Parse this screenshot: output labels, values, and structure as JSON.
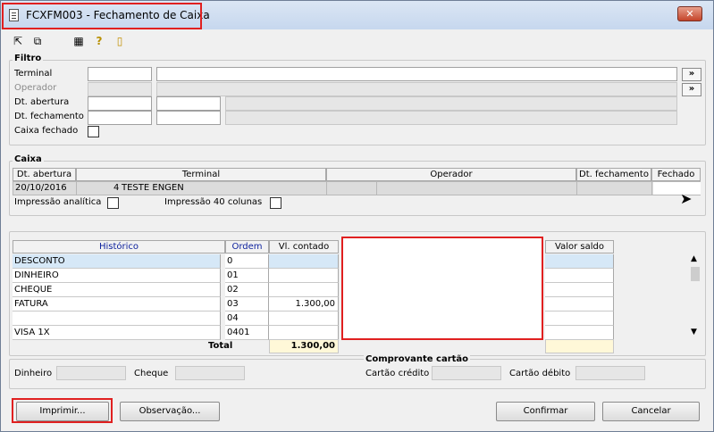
{
  "window": {
    "title": "FCXFM003 - Fechamento de Caixa",
    "close_label": "✕"
  },
  "toolbar": {
    "icons": [
      "first-record-icon",
      "multi-window-icon",
      "calendar-grid-icon",
      "help-icon",
      "exit-door-icon"
    ]
  },
  "filtro": {
    "title": "Filtro",
    "terminal_label": "Terminal",
    "operador_label": "Operador",
    "dt_abertura_label": "Dt. abertura",
    "dt_fechamento_label": "Dt. fechamento",
    "caixa_fechado_label": "Caixa fechado",
    "lookup_label": "»"
  },
  "caixa": {
    "title": "Caixa",
    "columns": [
      "Dt. abertura",
      "Terminal",
      "Operador",
      "Dt. fechamento",
      "Fechado"
    ],
    "row": {
      "dt_abertura": "20/10/2016",
      "terminal_num": "4",
      "terminal_name": "TESTE ENGEN"
    },
    "impressao_analitica_label": "Impressão analítica",
    "impressao_40_label": "Impressão 40 colunas"
  },
  "valores": {
    "columns": {
      "historico": "Histórico",
      "ordem": "Ordem",
      "vl_contado": "Vl. contado",
      "valor_saldo": "Valor saldo"
    },
    "rows": [
      {
        "historico": "DESCONTO",
        "ordem": "0",
        "vl_contado": ""
      },
      {
        "historico": "DINHEIRO",
        "ordem": "01",
        "vl_contado": ""
      },
      {
        "historico": "CHEQUE",
        "ordem": "02",
        "vl_contado": ""
      },
      {
        "historico": "FATURA",
        "ordem": "03",
        "vl_contado": "1.300,00"
      },
      {
        "historico": "",
        "ordem": "04",
        "vl_contado": ""
      },
      {
        "historico": "VISA 1X",
        "ordem": "0401",
        "vl_contado": ""
      }
    ],
    "total_label": "Total",
    "total_value": "1.300,00"
  },
  "footer_fields": {
    "dinheiro_label": "Dinheiro",
    "cheque_label": "Cheque",
    "comprovante_title": "Comprovante cartão",
    "cartao_credito_label": "Cartão crédito",
    "cartao_debito_label": "Cartão débito"
  },
  "buttons": {
    "imprimir": "Imprimir...",
    "observacao": "Observação...",
    "confirmar": "Confirmar",
    "cancelar": "Cancelar"
  },
  "colors": {
    "accent_blue": "#0b1f9c",
    "selected_row": "#d6e8f7",
    "highlight_red": "#e02020",
    "total_bg": "#fff8d8"
  }
}
